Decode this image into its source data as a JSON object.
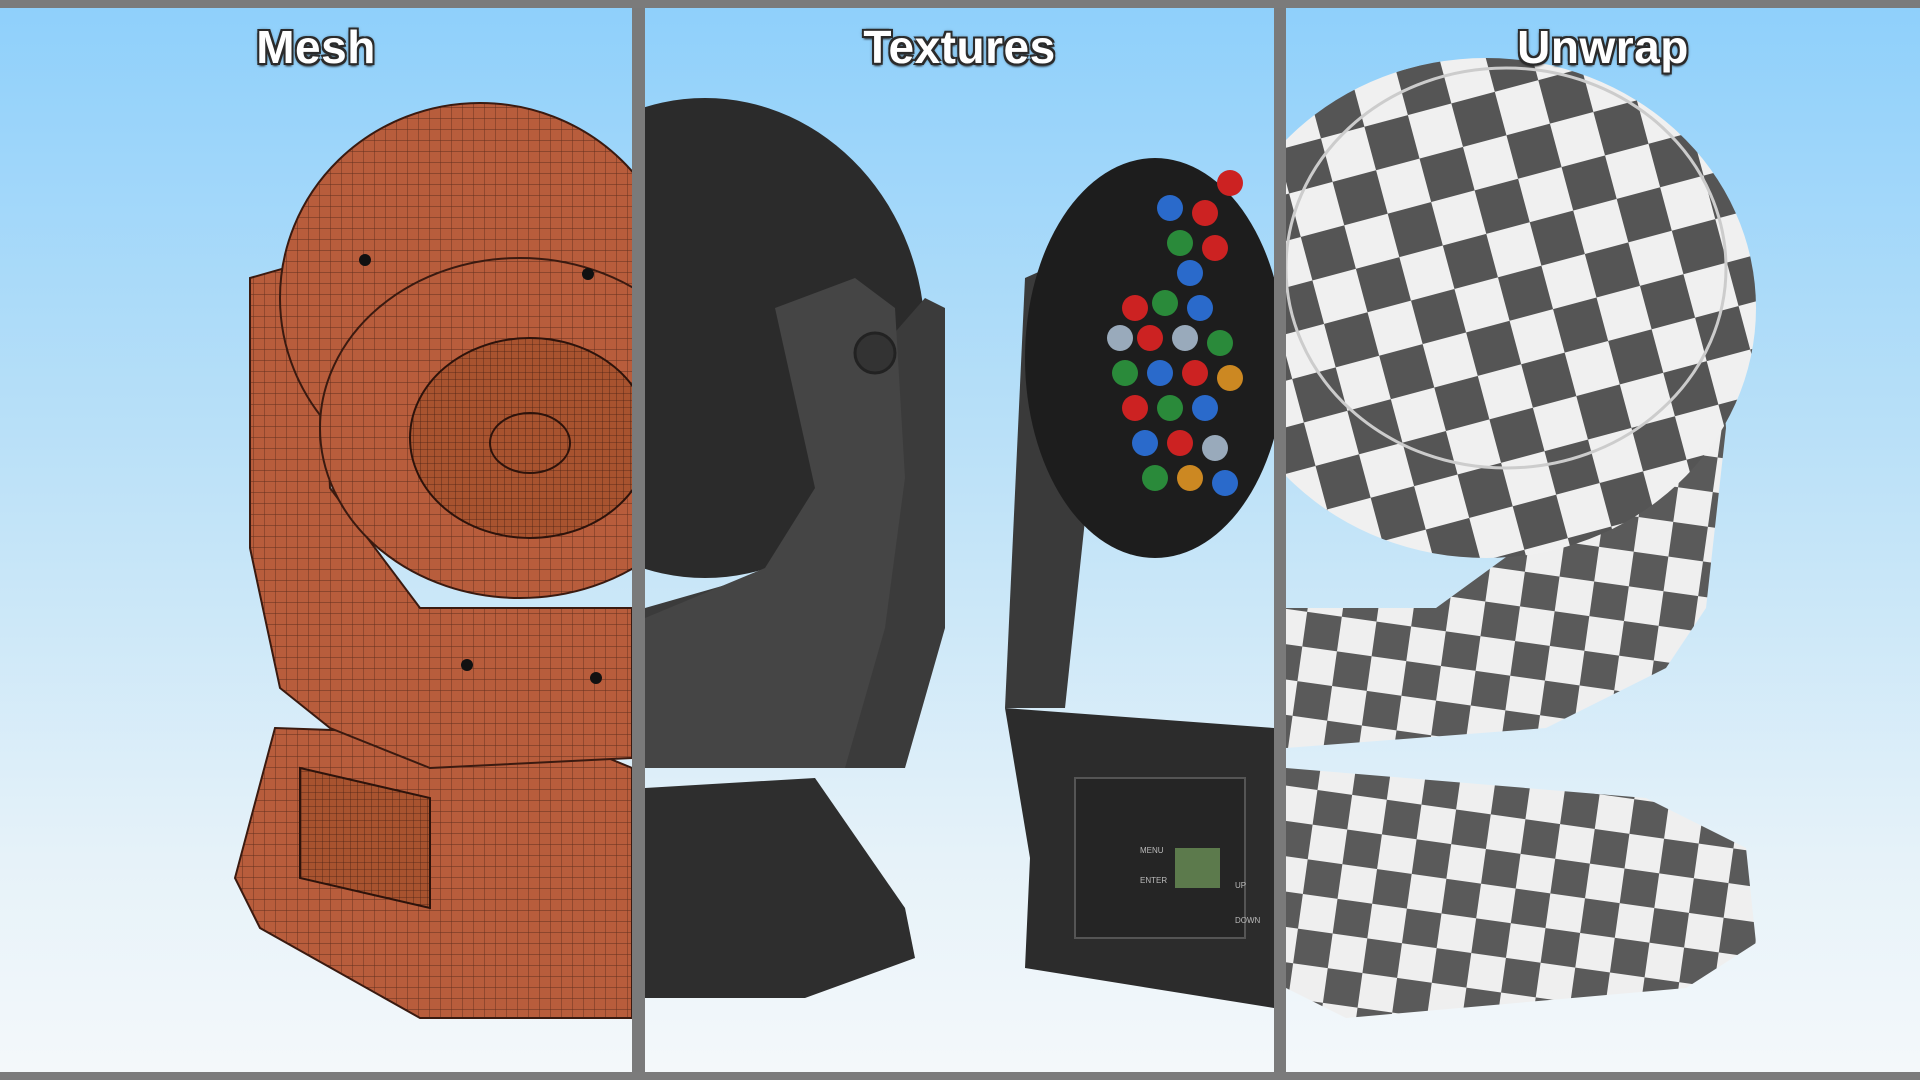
{
  "panels": [
    {
      "title": "Mesh",
      "render": "wireframe"
    },
    {
      "title": "Textures",
      "render": "textured"
    },
    {
      "title": "Unwrap",
      "render": "checker"
    }
  ],
  "colors": {
    "background_top": "#8fd0fb",
    "background_bottom": "#f4f8fa",
    "divider": "#7a7a7a",
    "mesh_fill": "#b85d3c",
    "mesh_line": "#3a1a10",
    "textured_body": "#3a3a3a",
    "checker_dark": "#555555",
    "checker_light": "#f0f0f0"
  },
  "lcd_panel": {
    "labels": [
      "MENU",
      "ENTER",
      "UP",
      "DOWN"
    ]
  }
}
